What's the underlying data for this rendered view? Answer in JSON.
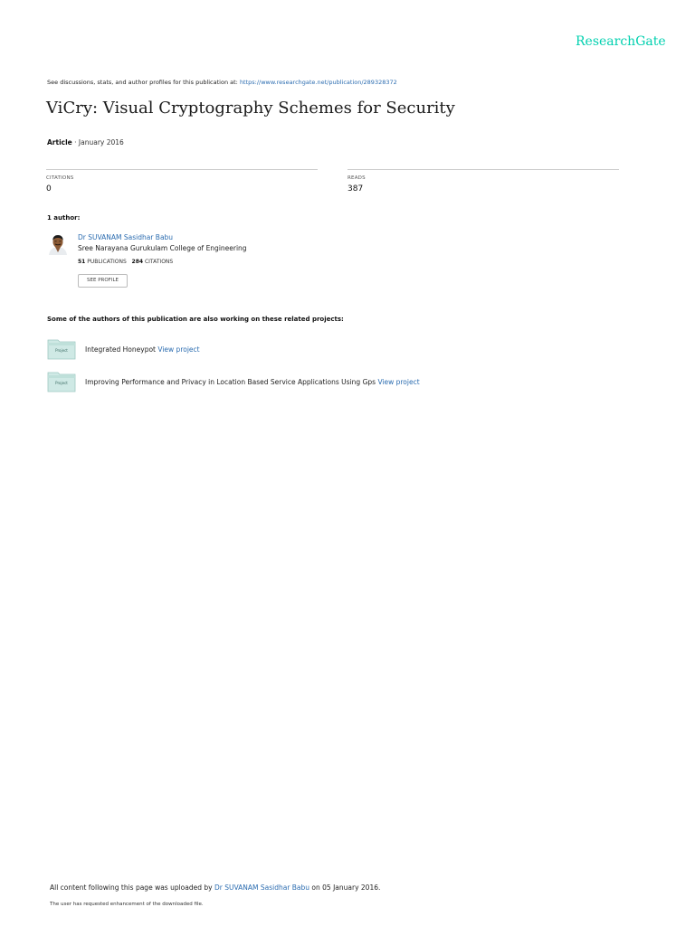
{
  "brand": {
    "logo_text": "ResearchGate",
    "color": "#00d0af"
  },
  "header": {
    "discussion_text": "See discussions, stats, and author profiles for this publication at: ",
    "publication_url": "https://www.researchgate.net/publication/289328372"
  },
  "article": {
    "title": "ViCry: Visual Cryptography Schemes for Security",
    "type": "Article",
    "date": " · January 2016"
  },
  "stats": {
    "citations_label": "CITATIONS",
    "citations_value": "0",
    "reads_label": "READS",
    "reads_value": "387"
  },
  "authors": {
    "heading": "1 author:",
    "items": [
      {
        "name": "Dr SUVANAM Sasidhar Babu",
        "institution": "Sree Narayana Gurukulam College of Engineering",
        "publications_count": "51",
        "publications_label": " PUBLICATIONS",
        "citations_count": "284",
        "citations_label": " CITATIONS",
        "profile_button": "SEE PROFILE"
      }
    ]
  },
  "related": {
    "heading": "Some of the authors of this publication are also working on these related projects:",
    "thumb_label": "Project",
    "thumb_color": "#cfe9e5",
    "projects": [
      {
        "title": "Integrated Honeypot ",
        "link": "View project"
      },
      {
        "title": "Improving Performance and Privacy in Location Based Service Applications Using Gps ",
        "link": "View project"
      }
    ]
  },
  "footer": {
    "uploaded_prefix": "All content following this page was uploaded by ",
    "uploader": "Dr SUVANAM Sasidhar Babu",
    "uploaded_suffix": " on 05 January 2016.",
    "enhancement_note": "The user has requested enhancement of the downloaded file."
  }
}
